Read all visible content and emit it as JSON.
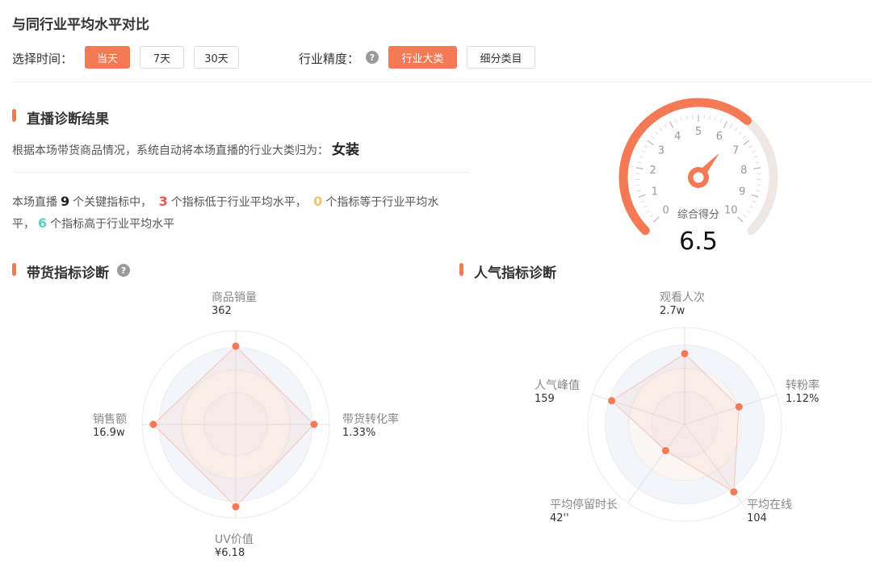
{
  "header": {
    "title": "与同行业平均水平对比"
  },
  "filters": {
    "time_label": "选择时间：",
    "time_options": [
      "当天",
      "7天",
      "30天"
    ],
    "time_selected": "当天",
    "precision_label": "行业精度：",
    "precision_help_icon": "question-circle-icon",
    "precision_options": [
      "行业大类",
      "细分类目"
    ],
    "precision_selected": "行业大类"
  },
  "diagnosis": {
    "title": "直播诊断结果",
    "category_sentence": "根据本场带货商品情况，系统自动将本场直播的行业大类归为：",
    "category": "女装",
    "summary": {
      "t1": "本场直播",
      "total": "9",
      "t2": "个关键指标中，",
      "below": "3",
      "t3": "个指标低于行业平均水平，",
      "equal": "0",
      "t4": "个指标等于行业平均水",
      "t5": "平，",
      "above": "6",
      "t6": "个指标高于行业平均水平"
    }
  },
  "colors": {
    "accent": "#f47a55",
    "red": "#e85454",
    "yellow": "#f2c36b",
    "teal": "#5ecfc5",
    "track": "#efe7e3"
  },
  "chart_data": [
    {
      "type": "gauge",
      "label": "综合得分",
      "value": 6.5,
      "value_text": "6.5",
      "min": 0,
      "max": 10,
      "ticks": [
        "0",
        "1",
        "2",
        "3",
        "4",
        "5",
        "6",
        "7",
        "8",
        "9",
        "10"
      ]
    },
    {
      "type": "radar",
      "title": "带货指标诊断",
      "help_icon": "question-circle-icon",
      "axes": [
        {
          "name": "商品销量",
          "value_text": "362",
          "score": 0.95
        },
        {
          "name": "带货转化率",
          "value_text": "1.33%",
          "score": 0.95
        },
        {
          "name": "UV价值",
          "value_text": "¥6.18",
          "score": 1.0
        },
        {
          "name": "销售额",
          "value_text": "16.9w",
          "score": 1.0
        }
      ]
    },
    {
      "type": "radar",
      "title": "人气指标诊断",
      "axes": [
        {
          "name": "观看人次",
          "value_text": "2.7w",
          "score": 0.83
        },
        {
          "name": "转粉率",
          "value_text": "1.12%",
          "score": 0.67
        },
        {
          "name": "平均在线",
          "value_text": "104",
          "score": 0.98
        },
        {
          "name": "平均停留时长",
          "value_text": "42''",
          "score": 0.38
        },
        {
          "name": "人气峰值",
          "value_text": "159",
          "score": 0.9
        }
      ]
    }
  ]
}
